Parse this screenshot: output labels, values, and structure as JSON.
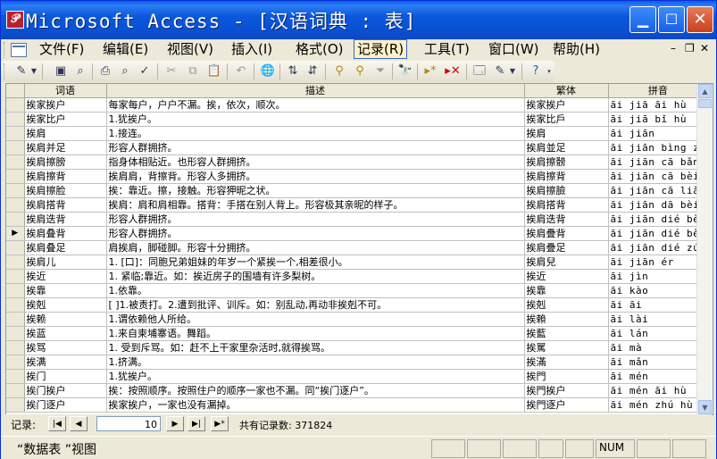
{
  "window": {
    "title": "Microsoft Access - [汉语词典 : 表]",
    "app_icon": "access-key-icon"
  },
  "menu": [
    {
      "label": "文件(F)"
    },
    {
      "label": "编辑(E)"
    },
    {
      "label": "视图(V)"
    },
    {
      "label": "插入(I)"
    },
    {
      "label": "格式(O)"
    },
    {
      "label": "记录(R)"
    },
    {
      "label": "工具(T)"
    },
    {
      "label": "窗口(W)"
    },
    {
      "label": "帮助(H)"
    }
  ],
  "toolbar": [
    "view-icon",
    "save-icon",
    "search-file-icon",
    "print-icon",
    "print-preview-icon",
    "spelling-icon",
    "cut-icon",
    "copy-icon",
    "paste-icon",
    "undo-icon",
    "insert-hyperlink-icon",
    "sort-ascending-icon",
    "sort-descending-icon",
    "filter-by-selection-icon",
    "filter-by-form-icon",
    "apply-filter-icon",
    "find-icon",
    "new-record-icon",
    "delete-record-icon",
    "database-window-icon",
    "new-object-icon",
    "help-icon"
  ],
  "table": {
    "columns": [
      "词语",
      "描述",
      "繁体",
      "拼音"
    ],
    "rows": [
      [
        "挨家挨户",
        "每家每户，户户不漏。挨，依次，顺次。",
        "挨家挨户",
        "āi jiā āi hù"
      ],
      [
        "挨家比户",
        "1.犹挨户。",
        "挨家比戶",
        "āi jiā bǐ hù"
      ],
      [
        "挨肩",
        "1.接连。",
        "挨肩",
        "āi jiān"
      ],
      [
        "挨肩并足",
        "形容人群拥挤。",
        "挨肩並足",
        "āi jiān bìng zú"
      ],
      [
        "挨肩擦膀",
        "指身体相贴近。也形容人群拥挤。",
        "挨肩擦髈",
        "āi jiān cā bǎng"
      ],
      [
        "挨肩擦背",
        "挨肩肩，背擦背。形容人多拥挤。",
        "挨肩擦背",
        "āi jiān cā bèi"
      ],
      [
        "挨肩擦脸",
        "挨：靠近。擦，接触。形容狎昵之状。",
        "挨肩擦臉",
        "āi jiān cā liǎn"
      ],
      [
        "挨肩搭背",
        "挨肩：肩和肩相靠。搭背：手搭在别人背上。形容极其亲昵的样子。",
        "挨肩搭背",
        "āi jiān dā bèi"
      ],
      [
        "挨肩迭背",
        "形容人群拥挤。",
        "挨肩迭背",
        "āi jiān dié bèi"
      ],
      [
        "挨肩叠背",
        "形容人群拥挤。",
        "挨肩疊背",
        "āi jiān dié bèi"
      ],
      [
        "挨肩叠足",
        "肩挨肩，脚碰脚。形容十分拥挤。",
        "挨肩疊足",
        "āi jiān dié zú"
      ],
      [
        "挨肩儿",
        "1. [口]：同胞兄弟姐妹的年岁一个紧挨一个,相差很小。",
        "挨肩兒",
        "āi jiān ér"
      ],
      [
        "挨近",
        "1. 紧临;靠近。如：挨近房子的围墙有许多梨树。",
        "挨近",
        "āi jìn"
      ],
      [
        "挨靠",
        "1.依靠。",
        "挨靠",
        "āi kào"
      ],
      [
        "挨剋",
        "[ ]1.被责打。2.遭到批评、训斥。如：别乱动,再动非挨剋不可。",
        "挨剋",
        "āi āi"
      ],
      [
        "挨赖",
        "1.谓依赖他人所给。",
        "挨賴",
        "āi lài"
      ],
      [
        "挨蓝",
        "1.来自柬埔寨语。舞蹈。",
        "挨藍",
        "āi lán"
      ],
      [
        "挨骂",
        "1. 受到斥骂。如：赶不上干家里杂活时,就得挨骂。",
        "挨駡",
        "āi mà"
      ],
      [
        "挨满",
        "1.挤满。",
        "挨滿",
        "āi mǎn"
      ],
      [
        "挨门",
        "1.犹挨户。",
        "挨門",
        "āi mén"
      ],
      [
        "挨门挨户",
        "挨：按照顺序。按照住户的顺序一家也不漏。同“挨门逐户”。",
        "挨門挨户",
        "āi mén āi hù"
      ],
      [
        "挨门逐户",
        "挨家挨户，一家也没有漏掉。",
        "挨門逐户",
        "āi mén zhú hù"
      ]
    ],
    "current_row_index": 9
  },
  "navigation": {
    "label": "记录:",
    "current_record": "10",
    "total_text": "共有记录数: 371824"
  },
  "status": {
    "view_text": "“数据表 ”视图",
    "num_indicator": "NUM"
  }
}
